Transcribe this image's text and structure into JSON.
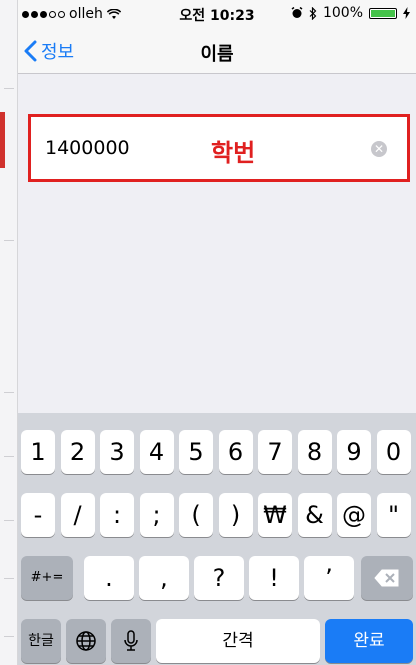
{
  "status_bar": {
    "carrier": "olleh",
    "time": "오전 10:23",
    "battery": "100%",
    "battery_level": 1.0
  },
  "nav": {
    "back_label": "정보",
    "title": "이름"
  },
  "field": {
    "value": "1400000",
    "annotation": "학번"
  },
  "keyboard": {
    "row1": [
      "1",
      "2",
      "3",
      "4",
      "5",
      "6",
      "7",
      "8",
      "9",
      "0"
    ],
    "row2": [
      "-",
      "/",
      ":",
      ";",
      "(",
      ")",
      "₩",
      "&",
      "@",
      "\""
    ],
    "row3": {
      "shift": "#+=",
      "keys": [
        ".",
        ",",
        "?",
        "!",
        "’"
      ]
    },
    "row4": {
      "lang": "한글",
      "space": "간격",
      "done": "완료"
    }
  },
  "colors": {
    "accent": "#1a7cf6",
    "highlight": "#e02020",
    "keyboard_bg": "#d2d5db"
  }
}
